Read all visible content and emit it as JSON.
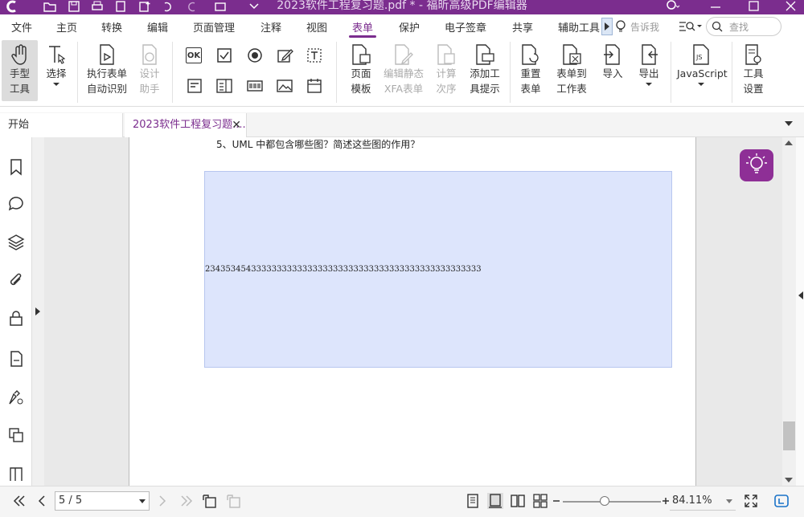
{
  "window": {
    "title": "2023软件工程复习题.pdf * - 福昕高级PDF编辑器"
  },
  "menu": {
    "tabs": [
      "文件",
      "主页",
      "转换",
      "编辑",
      "页面管理",
      "注释",
      "视图",
      "表单",
      "保护",
      "电子签章",
      "共享",
      "辅助工具"
    ],
    "active_tab": "表单",
    "tell_me_placeholder": "告诉我",
    "search_placeholder": "查找"
  },
  "ribbon": {
    "hand_tool": [
      "手型",
      "工具"
    ],
    "select": "选择",
    "run_form": [
      "执行表单",
      "自动识别"
    ],
    "design_assistant": [
      "设计",
      "助手"
    ],
    "page_template": [
      "页面",
      "模板"
    ],
    "edit_xfa": [
      "编辑静态",
      "XFA表单"
    ],
    "calc_order": [
      "计算",
      "次序"
    ],
    "add_tooltip": [
      "添加工",
      "具提示"
    ],
    "reset_form": [
      "重置",
      "表单"
    ],
    "form_to_sheet": [
      "表单到",
      "工作表"
    ],
    "import": "导入",
    "export": "导出",
    "javascript": "JavaScript",
    "tool_settings": [
      "工具",
      "设置"
    ],
    "ok_field_label": "OK"
  },
  "doc_tabs": {
    "start": "开始",
    "file": "2023软件工程复习题....",
    "close_glyph": "✕"
  },
  "document": {
    "question": "5、UML 中都包含哪些图？简述这些图的作用？",
    "field_value": "234353454333333333333333333333333333333333333333333333"
  },
  "status": {
    "page_indicator": "5 / 5",
    "zoom": "84.11%",
    "zoom_slider_fraction": 0.43
  },
  "colors": {
    "accent": "#7b2d8e",
    "field_fill": "#dde5fc",
    "assistant_bulb": "#8e2f96"
  }
}
